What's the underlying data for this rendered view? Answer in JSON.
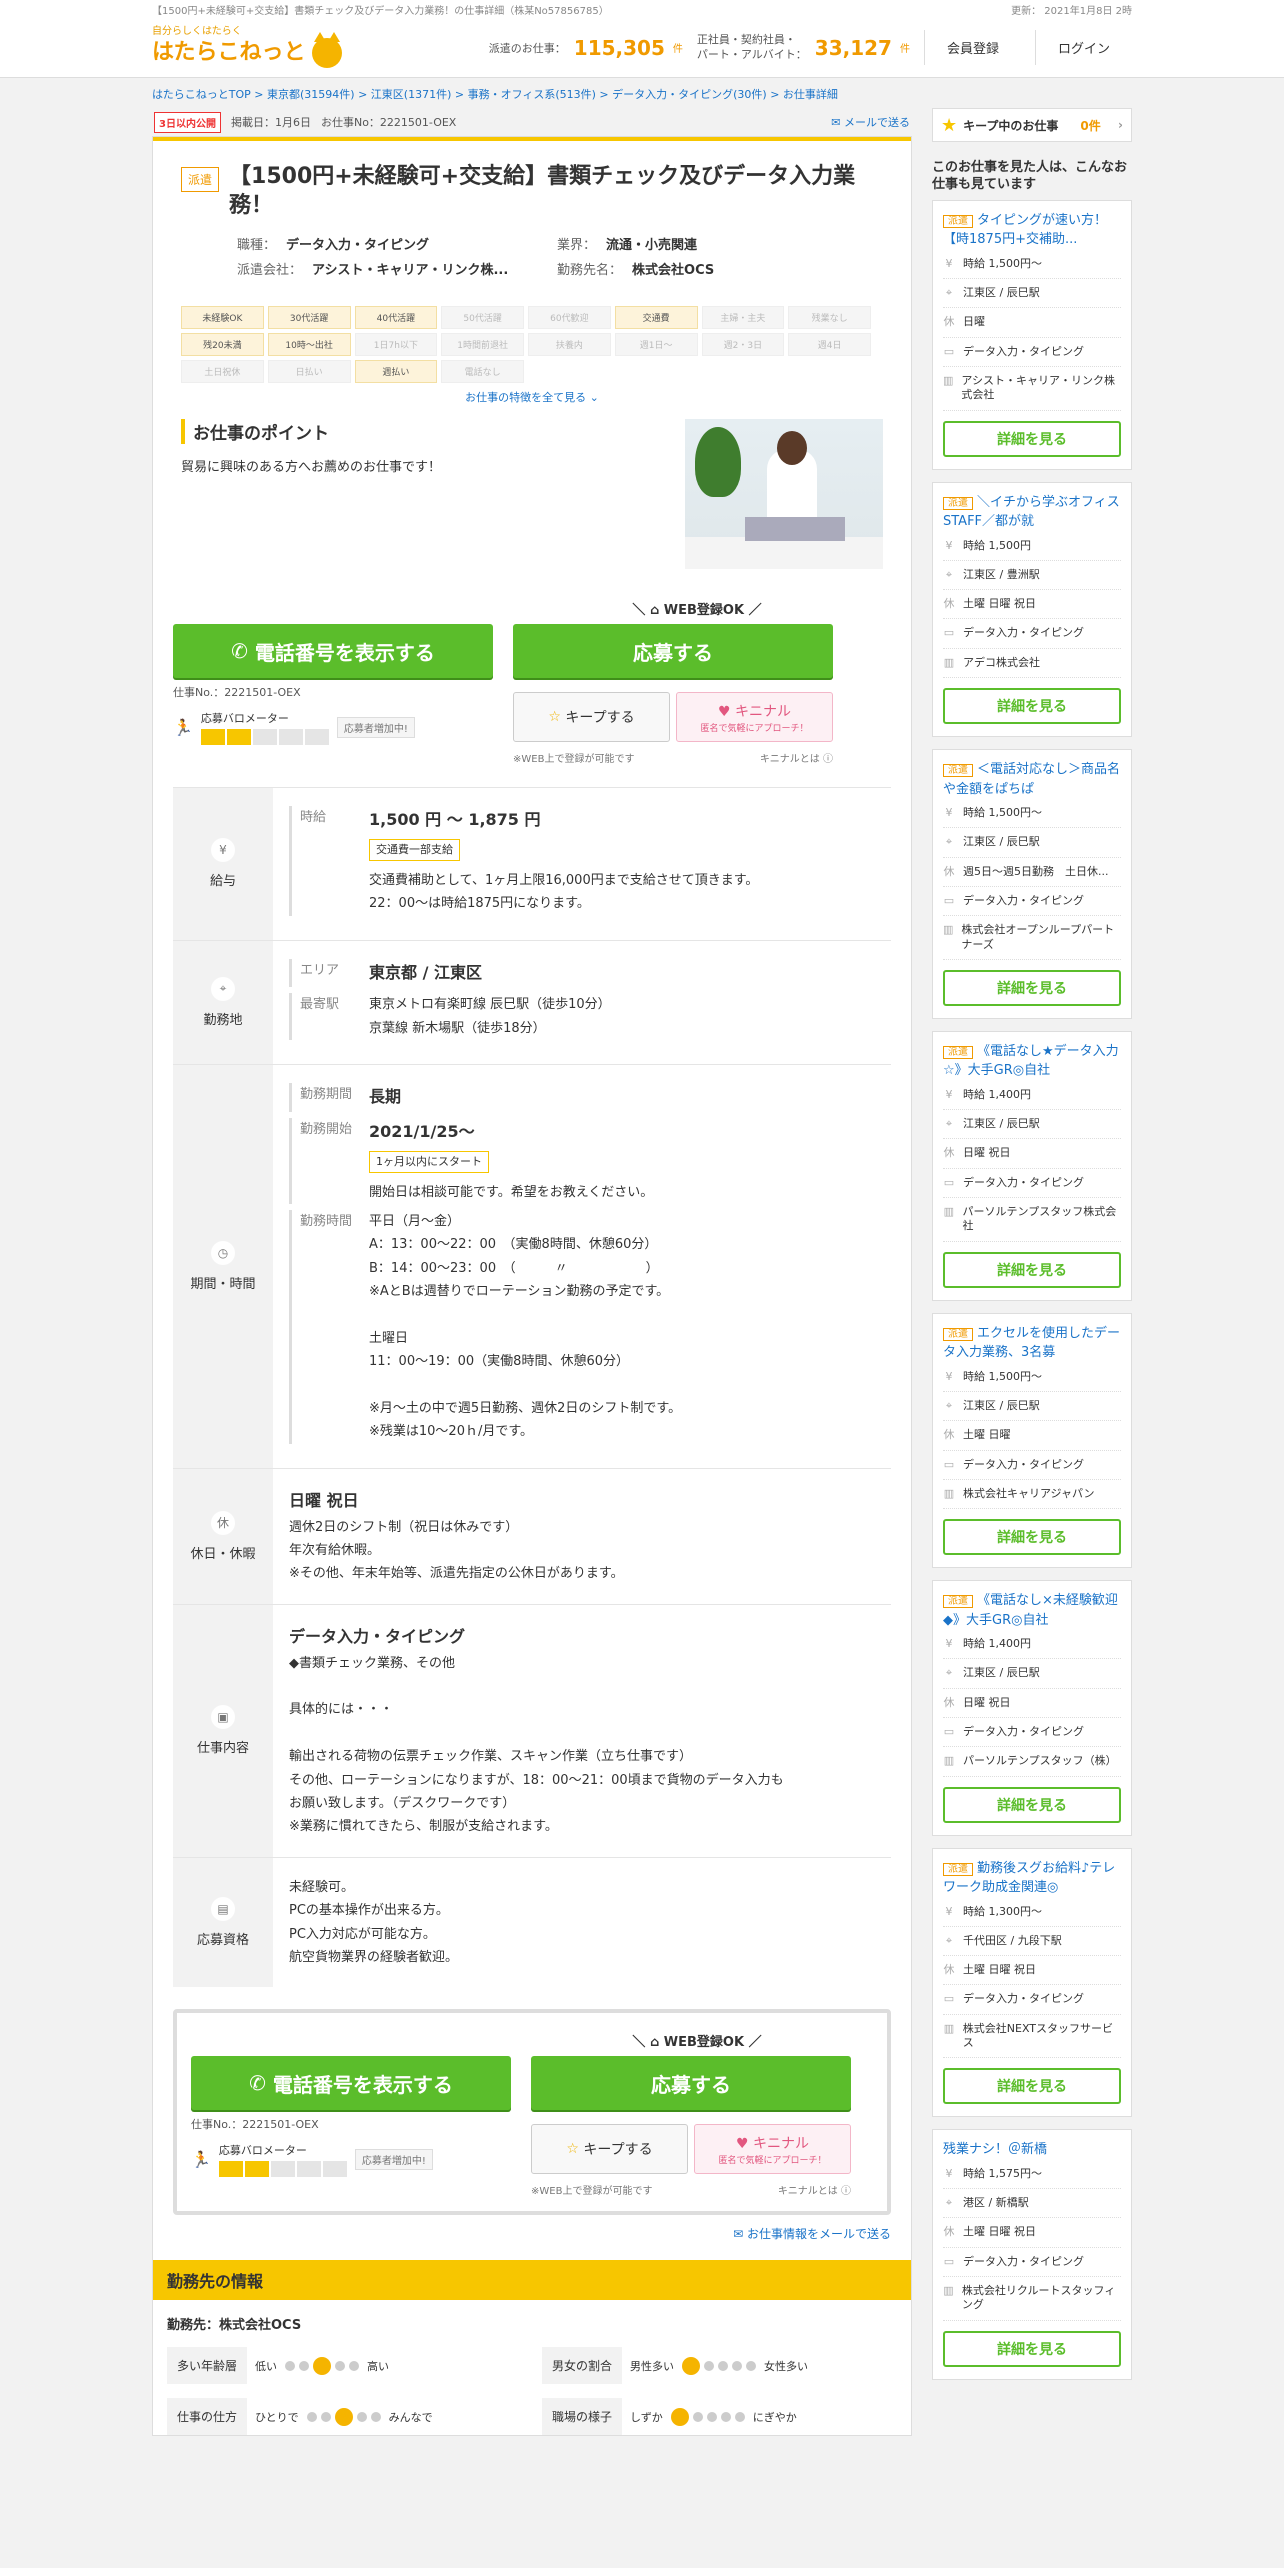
{
  "topbar": {
    "left": "【1500円+未経験可+交支給】書類チェック及びデータ入力業務！の仕事詳細（株某No57856785）",
    "right": "更新： 2021年1月8日 2時"
  },
  "header": {
    "tagline": "自分らしくはたらく",
    "logo": "はたらこねっと",
    "haken_label": "派遣のお仕事：",
    "haken_count": "115,305",
    "unit": "件",
    "other_label1": "正社員・契約社員・",
    "other_label2": "パート・アルバイト：",
    "other_count": "33,127",
    "register": "会員登録",
    "login": "ログイン"
  },
  "breadcrumb": "はたらこねっとTOP > 東京都(31594件) > 江東区(1371件) > 事務・オフィス系(513件) > データ入力・タイピング(30件) > お仕事詳細",
  "meta": {
    "badge": "3日以内公開",
    "posted": "掲載日：1月6日",
    "jobno": "お仕事No：2221501-OEX",
    "mail": "メールで送る"
  },
  "job": {
    "type": "派遣",
    "title": "【1500円+未経験可+交支給】書類チェック及びデータ入力業務！",
    "k1": "職種：",
    "v1": "データ入力・タイピング",
    "k2": "業界：",
    "v2": "流通・小売関連",
    "k3": "派遣会社：",
    "v3": "アシスト・キャリア・リンク株...",
    "k4": "勤務先名：",
    "v4": "株式会社OCS"
  },
  "tags": [
    {
      "t": "未経験OK",
      "on": true
    },
    {
      "t": "30代活躍",
      "on": true
    },
    {
      "t": "40代活躍",
      "on": true
    },
    {
      "t": "50代活躍",
      "on": false
    },
    {
      "t": "60代歓迎",
      "on": false
    },
    {
      "t": "交通費",
      "on": true
    },
    {
      "t": "主婦・主夫",
      "on": false
    },
    {
      "t": "残業なし",
      "on": false
    },
    {
      "t": "残20未満",
      "on": true
    },
    {
      "t": "10時～出社",
      "on": true
    },
    {
      "t": "1日7h以下",
      "on": false
    },
    {
      "t": "1時間前退社",
      "on": false
    },
    {
      "t": "扶養内",
      "on": false
    },
    {
      "t": "週1日～",
      "on": false
    },
    {
      "t": "週2・3日",
      "on": false
    },
    {
      "t": "週4日",
      "on": false
    },
    {
      "t": "土日祝休",
      "on": false
    },
    {
      "t": "日払い",
      "on": false
    },
    {
      "t": "週払い",
      "on": true
    },
    {
      "t": "電話なし",
      "on": false
    }
  ],
  "seeall": "お仕事の特徴を全て見る ⌄",
  "point": {
    "head": "お仕事のポイント",
    "text": "貿易に興味のある方へお薦めのお仕事です！"
  },
  "cta": {
    "webok": "WEB登録OK",
    "phone": "電話番号を表示する",
    "apply": "応募する",
    "jobno": "仕事No.：2221501-OEX",
    "meter": "応募バロメーター",
    "increase": "応募者増加中!",
    "keep": "キープする",
    "kinenal": "キニナル",
    "kinenal_sub": "匿名で気軽にアプローチ！",
    "webnote": "※WEB上で登録が可能です",
    "kinenal_help": "キニナルとは"
  },
  "pay": {
    "label": "給与",
    "k": "時給",
    "range": "1,500 円 ～ 1,875 円",
    "tag": "交通費一部支給",
    "note": "交通費補助として、1ヶ月上限16,000円まで支給させて頂きます。\n22：00～は時給1875円になります。"
  },
  "place": {
    "label": "勤務地",
    "k1": "エリア",
    "area": "東京都 / 江東区",
    "k2": "最寄駅",
    "station": "東京メトロ有楽町線 辰巳駅（徒歩10分）\n京葉線 新木場駅（徒歩18分）"
  },
  "period": {
    "label": "期間・時間",
    "k1": "勤務期間",
    "v1": "長期",
    "k2": "勤務開始",
    "v2": "2021/1/25～",
    "tag": "1ヶ月以内にスタート",
    "start_note": "開始日は相談可能です。希望をお教えください。",
    "k3": "勤務時間",
    "hours": "平日（月～金）\nA：13：00～22：00　（実働8時間、休憩60分）\nB：14：00～23：00　（　　　〃　　　　　　）\n※AとBは週替りでローテーション勤務の予定です。\n\n土曜日\n11：00～19：00（実働8時間、休憩60分）\n\n※月～土の中で週5日勤務、週休2日のシフト制です。\n※残業は10～20ｈ/月です。"
  },
  "holiday": {
    "label": "休日・休暇",
    "head": "日曜 祝日",
    "text": "週休2日のシフト制（祝日は休みです）\n年次有給休暇。\n※その他、年末年始等、派遣先指定の公休日があります。"
  },
  "work": {
    "label": "仕事内容",
    "head": "データ入力・タイピング",
    "text": "◆書類チェック業務、その他\n\n具体的には・・・\n\n輸出される荷物の伝票チェック作業、スキャン作業（立ち仕事です）\nその他、ローテーションになりますが、18：00～21：00頃まで貨物のデータ入力も\nお願い致します。（デスクワークです）\n※業務に慣れてきたら、制服が支給されます。"
  },
  "qual": {
    "label": "応募資格",
    "text": "未経験可。\nPCの基本操作が出来る方。\nPC入力対応が可能な方。\n航空貨物業界の経験者歓迎。"
  },
  "mail_bottom": "お仕事情報をメールで送る",
  "company": {
    "head": "勤務先の情報",
    "name": "勤務先：株式会社OCS",
    "sliders": [
      {
        "label": "多い年齢層",
        "left": "低い",
        "right": "高い",
        "ticks": [
          "10代",
          "20代",
          "30代",
          "40代",
          "50代"
        ],
        "pos": 2
      },
      {
        "label": "男女の割合",
        "left": "男性多い",
        "right": "女性多い",
        "ticks": [],
        "pos": 0
      },
      {
        "label": "仕事の仕方",
        "left": "ひとりで",
        "right": "みんなで",
        "ticks": [],
        "pos": 2
      },
      {
        "label": "職場の様子",
        "left": "しずか",
        "right": "にぎやか",
        "ticks": [],
        "pos": 0
      }
    ]
  },
  "side": {
    "keep": "キープ中のお仕事",
    "keep_count": "0件",
    "head": "このお仕事を見た人は、こんなお仕事も見ています",
    "detail": "詳細を見る",
    "cards": [
      {
        "type": "派遣",
        "title": "タイピングが速い方！【時1875円+交補助...",
        "pay": "時給 1,500円～",
        "place": "江東区 / 辰巳駅",
        "holiday": "日曜",
        "job": "データ入力・タイピング",
        "company": "アシスト・キャリア・リンク株式会社"
      },
      {
        "type": "派遣",
        "title": "＼イチから学ぶオフィスSTAFF／都が就",
        "pay": "時給 1,500円",
        "place": "江東区 / 豊洲駅",
        "holiday": "土曜 日曜 祝日",
        "job": "データ入力・タイピング",
        "company": "アデコ株式会社"
      },
      {
        "type": "派遣",
        "title": "＜電話対応なし＞商品名や金額をぱちぱ",
        "pay": "時給 1,500円～",
        "place": "江東区 / 辰巳駅",
        "holiday": "週5日～週5日勤務　土日休...",
        "job": "データ入力・タイピング",
        "company": "株式会社オープンループパートナーズ"
      },
      {
        "type": "派遣",
        "title": "《電話なし★データ入力☆》大手GR◎自社",
        "pay": "時給 1,400円",
        "place": "江東区 / 辰巳駅",
        "holiday": "日曜 祝日",
        "job": "データ入力・タイピング",
        "company": "パーソルテンプスタッフ株式会社"
      },
      {
        "type": "派遣",
        "title": "エクセルを使用したデータ入力業務、3名募",
        "pay": "時給 1,500円～",
        "place": "江東区 / 辰巳駅",
        "holiday": "土曜 日曜",
        "job": "データ入力・タイピング",
        "company": "株式会社キャリアジャパン"
      },
      {
        "type": "派遣",
        "title": "《電話なし×未経験歓迎◆》大手GR◎自社",
        "pay": "時給 1,400円",
        "place": "江東区 / 辰巳駅",
        "holiday": "日曜 祝日",
        "job": "データ入力・タイピング",
        "company": "パーソルテンプスタッフ（株）"
      },
      {
        "type": "派遣",
        "title": "勤務後スグお給料♪テレワーク助成金関連◎",
        "pay": "時給 1,300円～",
        "place": "千代田区 / 九段下駅",
        "holiday": "土曜 日曜 祝日",
        "job": "データ入力・タイピング",
        "company": "株式会社NEXTスタッフサービス"
      },
      {
        "type": "",
        "title": "残業ナシ！＠新橋",
        "pay": "時給 1,575円～",
        "place": "港区 / 新橋駅",
        "holiday": "土曜 日曜 祝日",
        "job": "データ入力・タイピング",
        "company": "株式会社リクルートスタッフィング"
      }
    ]
  }
}
